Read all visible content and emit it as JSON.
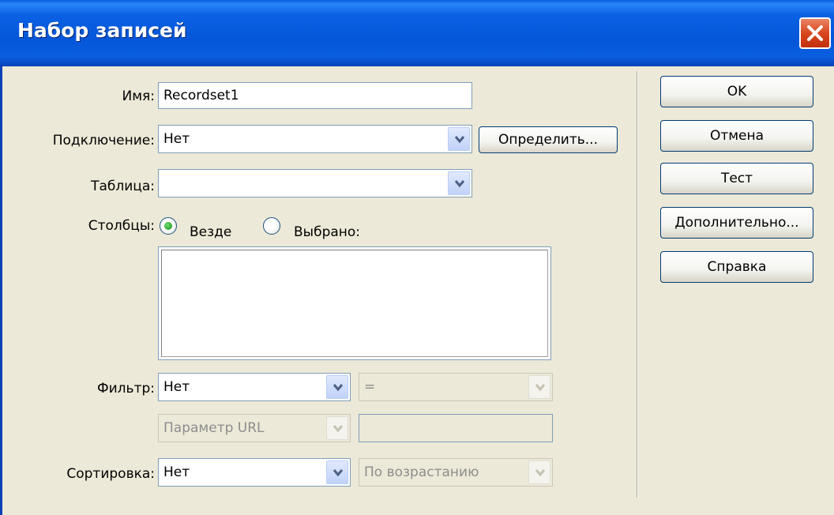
{
  "window": {
    "title": "Набор записей"
  },
  "form": {
    "name_label": "Имя:",
    "name_value": "Recordset1",
    "connection_label": "Подключение:",
    "connection_value": "Нет",
    "define_button": "Определить...",
    "table_label": "Таблица:",
    "table_value": "",
    "columns_label": "Столбцы:",
    "columns_all": "Везде",
    "columns_selected": "Выбрано:",
    "filter_label": "Фильтр:",
    "filter_value": "Нет",
    "filter_operator": "=",
    "filter_param_type": "Параметр URL",
    "filter_param_value": "",
    "sort_label": "Сортировка:",
    "sort_value": "Нет",
    "sort_order": "По возрастанию"
  },
  "buttons": {
    "ok": "OK",
    "cancel": "Отмена",
    "test": "Тест",
    "advanced": "Дополнительно...",
    "help": "Справка"
  },
  "colors": {
    "titlebar": "#0a5ee0",
    "dialog_bg": "#ece9d8",
    "radio_checked": "#21a121",
    "close": "#d8471e"
  }
}
